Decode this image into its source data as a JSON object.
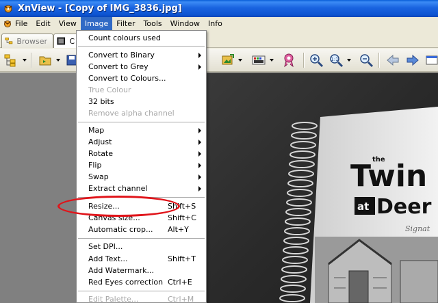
{
  "window": {
    "title": "XnView - [Copy of IMG_3836.jpg]"
  },
  "menubar": {
    "items": [
      "File",
      "Edit",
      "View",
      "Image",
      "Filter",
      "Tools",
      "Window",
      "Info"
    ],
    "active": "Image"
  },
  "tabs": {
    "browser": "Browser",
    "image": "C"
  },
  "image_menu": {
    "items": [
      {
        "label": "Count colours used",
        "shortcut": "",
        "submenu": false,
        "enabled": true
      },
      {
        "label": "Convert to Binary",
        "shortcut": "",
        "submenu": true,
        "enabled": true
      },
      {
        "label": "Convert to Grey",
        "shortcut": "",
        "submenu": true,
        "enabled": true
      },
      {
        "label": "Convert to Colours...",
        "shortcut": "",
        "submenu": false,
        "enabled": true
      },
      {
        "label": "True Colour",
        "shortcut": "",
        "submenu": false,
        "enabled": false
      },
      {
        "label": "32 bits",
        "shortcut": "",
        "submenu": false,
        "enabled": true
      },
      {
        "label": "Remove alpha channel",
        "shortcut": "",
        "submenu": false,
        "enabled": false
      },
      {
        "label": "Map",
        "shortcut": "",
        "submenu": true,
        "enabled": true
      },
      {
        "label": "Adjust",
        "shortcut": "",
        "submenu": true,
        "enabled": true
      },
      {
        "label": "Rotate",
        "shortcut": "",
        "submenu": true,
        "enabled": true
      },
      {
        "label": "Flip",
        "shortcut": "",
        "submenu": true,
        "enabled": true
      },
      {
        "label": "Swap",
        "shortcut": "",
        "submenu": true,
        "enabled": true
      },
      {
        "label": "Extract channel",
        "shortcut": "",
        "submenu": true,
        "enabled": true
      },
      {
        "label": "Resize...",
        "shortcut": "Shift+S",
        "submenu": false,
        "enabled": true
      },
      {
        "label": "Canvas size...",
        "shortcut": "Shift+C",
        "submenu": false,
        "enabled": true
      },
      {
        "label": "Automatic crop...",
        "shortcut": "Alt+Y",
        "submenu": false,
        "enabled": true
      },
      {
        "label": "Set DPI...",
        "shortcut": "",
        "submenu": false,
        "enabled": true
      },
      {
        "label": "Add Text...",
        "shortcut": "Shift+T",
        "submenu": false,
        "enabled": true
      },
      {
        "label": "Add Watermark...",
        "shortcut": "",
        "submenu": false,
        "enabled": true
      },
      {
        "label": "Red Eyes correction",
        "shortcut": "Ctrl+E",
        "submenu": false,
        "enabled": true
      },
      {
        "label": "Edit Palette...",
        "shortcut": "Ctrl+M",
        "submenu": false,
        "enabled": false
      }
    ]
  },
  "photo": {
    "book_title_line1": "the",
    "book_title_line2": "Twin",
    "book_title_line3": "at",
    "book_title_line4": "Deer C",
    "book_signature": "Signat"
  },
  "colors": {
    "highlight": "#316ac5",
    "annotation": "#e0141a"
  }
}
